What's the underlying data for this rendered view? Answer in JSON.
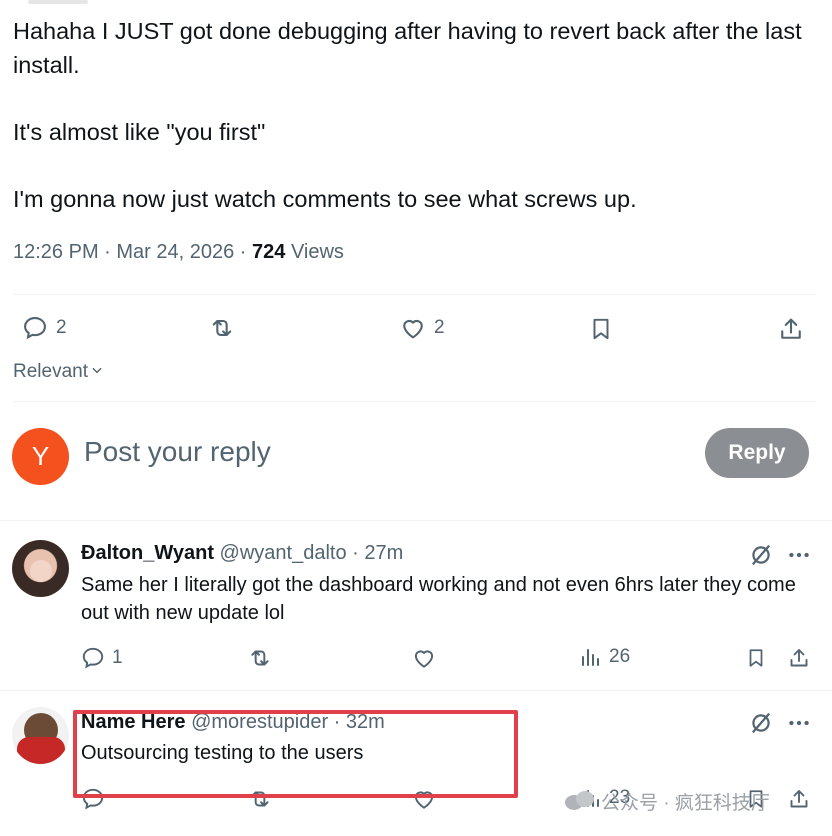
{
  "tweet": {
    "lines": [
      "Hahaha I JUST got done debugging after having to revert back after the last install.",
      "It's almost like \"you first\"",
      "I'm gonna now just watch comments to see what screws up."
    ],
    "time": "12:26 PM · Mar 24, 2026 · ",
    "views_count": "724",
    "views_label": " Views",
    "replies": "2",
    "likes": "2"
  },
  "sort": {
    "label": "Relevant"
  },
  "composer": {
    "avatar_letter": "Y",
    "placeholder": "Post your reply",
    "button": "Reply",
    "avatar_color": "#f4511e"
  },
  "comments": [
    {
      "name": "Đalton_Wyant",
      "handle": "@wyant_dalto",
      "time": " · 27m",
      "text": "Same her I literally got the dashboard working and not even 6hrs later they come out with new update lol",
      "replies": "1",
      "views": "26"
    },
    {
      "name": "Name Here",
      "handle": "@morestupider",
      "time": " · 32m",
      "text": "Outsourcing testing to the users",
      "views": "23"
    }
  ],
  "watermark": {
    "text": "公众号 · 疯狂科技厅"
  },
  "colors": {
    "highlight": "#e0404a",
    "muted": "#536471",
    "text": "#0f1419",
    "reply_button": "#8b8f93"
  }
}
